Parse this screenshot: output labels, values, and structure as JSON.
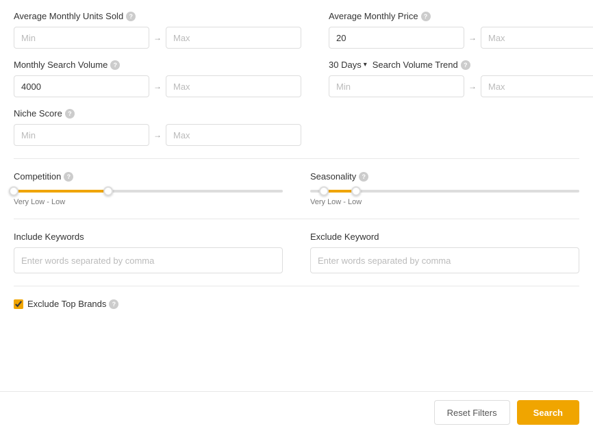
{
  "filters": {
    "avg_monthly_units_sold": {
      "label": "Average Monthly Units Sold",
      "min_placeholder": "Min",
      "max_placeholder": "Max",
      "min_value": "",
      "max_value": ""
    },
    "avg_monthly_price": {
      "label": "Average Monthly Price",
      "min_value": "20",
      "max_placeholder": "Max"
    },
    "monthly_search_volume": {
      "label": "Monthly Search Volume",
      "min_value": "4000",
      "max_placeholder": "Max"
    },
    "search_volume_trend": {
      "dropdown_label": "30 Days",
      "label": "Search Volume Trend",
      "min_placeholder": "Min",
      "max_placeholder": "Max"
    },
    "niche_score": {
      "label": "Niche Score",
      "min_placeholder": "Min",
      "max_placeholder": "Max"
    },
    "competition": {
      "label": "Competition",
      "range_label": "Very Low  -  Low",
      "left_pct": 0,
      "right_pct": 35
    },
    "seasonality": {
      "label": "Seasonality",
      "range_label": "Very Low  -  Low",
      "left_pct": 5,
      "right_pct": 17
    },
    "include_keywords": {
      "label": "Include Keywords",
      "placeholder": "Enter words separated by comma"
    },
    "exclude_keyword": {
      "label": "Exclude Keyword",
      "placeholder": "Enter words separated by comma"
    },
    "exclude_top_brands": {
      "label": "Exclude Top Brands",
      "checked": true
    }
  },
  "buttons": {
    "reset": "Reset Filters",
    "search": "Search"
  },
  "help_icon": "?",
  "arrow": "→"
}
